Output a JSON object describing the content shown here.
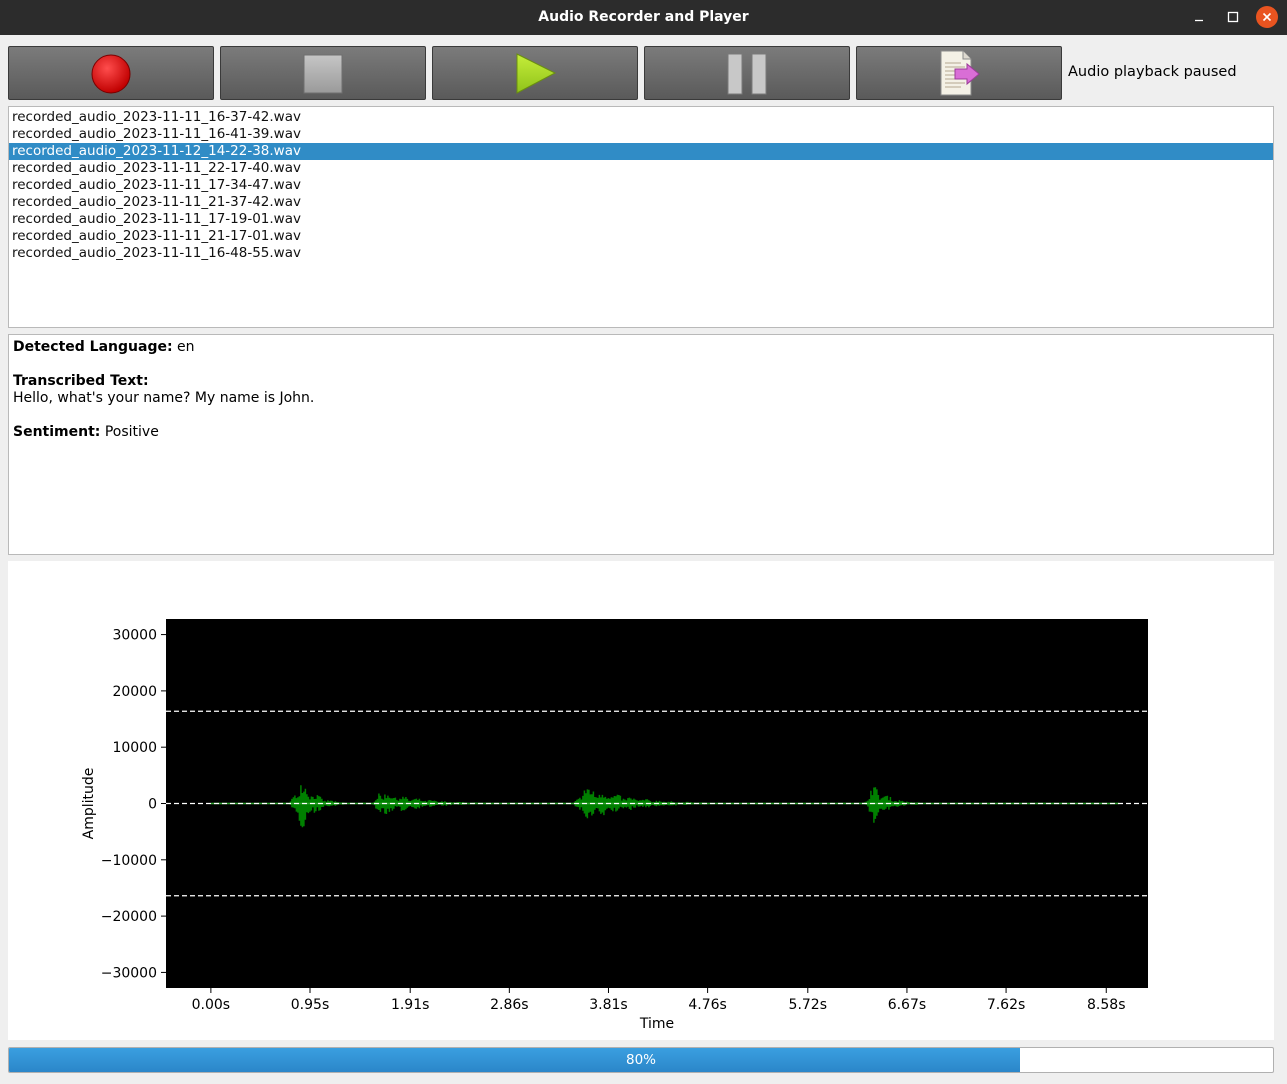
{
  "window": {
    "title": "Audio Recorder and Player"
  },
  "toolbar": {
    "buttons": [
      {
        "name": "record-button",
        "icon": "record-icon"
      },
      {
        "name": "stop-button",
        "icon": "stop-icon"
      },
      {
        "name": "play-button",
        "icon": "play-icon"
      },
      {
        "name": "pause-button",
        "icon": "pause-icon"
      },
      {
        "name": "transcribe-button",
        "icon": "document-arrow-icon"
      }
    ],
    "status": "Audio playback paused"
  },
  "files": {
    "items": [
      "recorded_audio_2023-11-11_16-37-42.wav",
      "recorded_audio_2023-11-11_16-41-39.wav",
      "recorded_audio_2023-11-12_14-22-38.wav",
      "recorded_audio_2023-11-11_22-17-40.wav",
      "recorded_audio_2023-11-11_17-34-47.wav",
      "recorded_audio_2023-11-11_21-37-42.wav",
      "recorded_audio_2023-11-11_17-19-01.wav",
      "recorded_audio_2023-11-11_21-17-01.wav",
      "recorded_audio_2023-11-11_16-48-55.wav"
    ],
    "selected_index": 2
  },
  "analysis": {
    "language_label": "Detected Language:",
    "language_value": "en",
    "transcript_label": "Transcribed Text:",
    "transcript_value": "Hello, what's your name? My name is John.",
    "sentiment_label": "Sentiment:",
    "sentiment_value": "Positive"
  },
  "chart_data": {
    "type": "line",
    "title": "",
    "xlabel": "Time",
    "ylabel": "Amplitude",
    "xticks": [
      "0.00s",
      "0.95s",
      "1.91s",
      "2.86s",
      "3.81s",
      "4.76s",
      "5.72s",
      "6.67s",
      "7.62s",
      "8.58s"
    ],
    "xtick_values": [
      0.0,
      0.95,
      1.91,
      2.86,
      3.81,
      4.76,
      5.72,
      6.67,
      7.62,
      8.58
    ],
    "yticks": [
      "30000",
      "20000",
      "10000",
      "0",
      "−10000",
      "−20000",
      "−30000"
    ],
    "ytick_values": [
      30000,
      20000,
      10000,
      0,
      -10000,
      -20000,
      -30000
    ],
    "xlim": [
      -0.43,
      8.98
    ],
    "ylim": [
      -32768,
      32767
    ],
    "background": "#000000",
    "waveform_color": "#008000",
    "reference_lines": [
      16384,
      0,
      -16384
    ],
    "reference_line_color": "#ffffff",
    "series": [
      {
        "bursts": [
          {
            "start": 0.75,
            "peak": 0.87,
            "end": 1.28,
            "amp": 4800
          },
          {
            "start": 1.55,
            "peak": 1.62,
            "end": 2.72,
            "amp": 2500
          },
          {
            "start": 3.47,
            "peak": 3.6,
            "end": 4.78,
            "amp": 3500
          },
          {
            "start": 6.26,
            "peak": 6.34,
            "end": 6.8,
            "amp": 3800
          }
        ],
        "x_end": 8.7
      }
    ]
  },
  "progress": {
    "value": 80,
    "label": "80%"
  },
  "colors": {
    "titlebar": "#2c2c2c",
    "close_button": "#e95420",
    "selection": "#308cc6",
    "progress_fill": "#2b86c9"
  }
}
